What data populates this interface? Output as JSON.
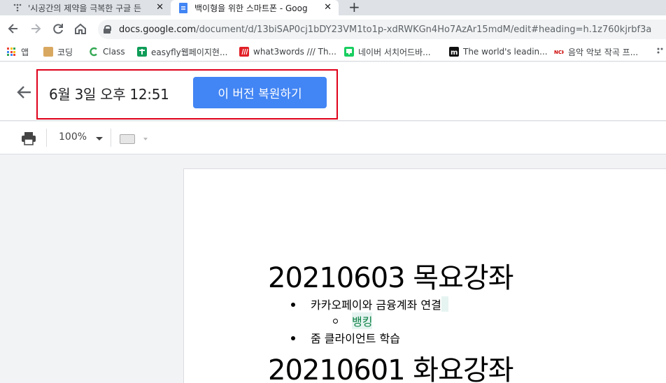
{
  "browser": {
    "tabs": [
      {
        "title": "'시공간의 제약을 극복한 구글 든",
        "active": false
      },
      {
        "title": "백이형을 위한 스마트폰 - Goog",
        "active": true
      }
    ],
    "close_glyph": "✕",
    "new_tab_glyph": "+",
    "url": {
      "host": "docs.google.com",
      "path": "/document/d/13biSAP0cj1bDY23VM1to1p-xdRWKGn4Ho7AzAr15mdM/edit#heading=h.1z760kjrbf3a"
    },
    "bookmarks": [
      {
        "label": "앱",
        "icon": "apps-grid-icon"
      },
      {
        "label": "코딩",
        "icon": "dog-icon"
      },
      {
        "label": "Class",
        "icon": "class-c-icon"
      },
      {
        "label": "easyfly웹페이지현...",
        "icon": "green-plus-icon"
      },
      {
        "label": "what3words /// Th...",
        "icon": "what3words-icon"
      },
      {
        "label": "네이버 서치어드바...",
        "icon": "naver-icon"
      },
      {
        "label": "The world's leadin...",
        "icon": "m-icon"
      },
      {
        "label": "음악 악보 작곡 프...",
        "icon": "noteflight-icon"
      }
    ]
  },
  "docs": {
    "version_time": "6월 3일 오후 12:51",
    "restore_label": "이 버전 복원하기",
    "zoom": "100%"
  },
  "document": {
    "heading1": "20210603 목요강좌",
    "bullet1": "카카오페이와 금융계좌 연결",
    "sub_bullet": "뱅킹",
    "bullet2": "줌 클라이언트 학습",
    "heading2": "20210601 화요강좌"
  },
  "colors": {
    "accent_blue": "#4285f4",
    "highlight_red": "#e0001b"
  }
}
